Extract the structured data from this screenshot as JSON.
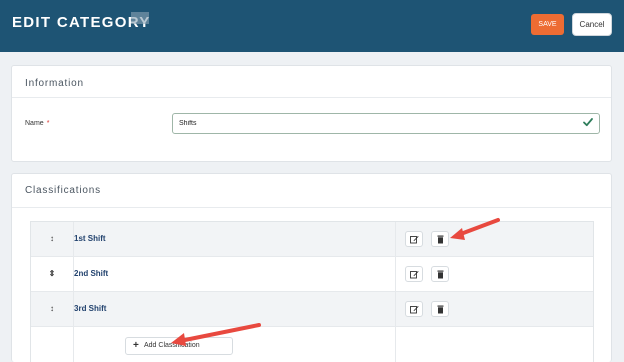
{
  "header": {
    "title": "EDIT CATEGORY",
    "save_label": "SAVE",
    "cancel_label": "Cancel"
  },
  "information": {
    "title": "Information",
    "name_label": "Name",
    "required_mark": "*",
    "name_value": "Shifts"
  },
  "classifications": {
    "title": "Classifications",
    "rows": [
      {
        "handle": "↕",
        "name": "1st Shift"
      },
      {
        "handle": "⇕",
        "name": "2nd Shift"
      },
      {
        "handle": "↕",
        "name": "3rd Shift"
      }
    ],
    "add_label": "Add Classification",
    "add_icon": "+"
  },
  "colors": {
    "header_bg": "#1e5474",
    "save_bg": "#ed6c33",
    "link_text": "#22426e",
    "arrow": "#e8493f",
    "valid_check": "#2e7d5b"
  },
  "icons": {
    "edit": "edit-icon",
    "delete": "trash-icon",
    "drag": "drag-handle-icon",
    "valid": "check-icon",
    "add": "plus-icon"
  }
}
